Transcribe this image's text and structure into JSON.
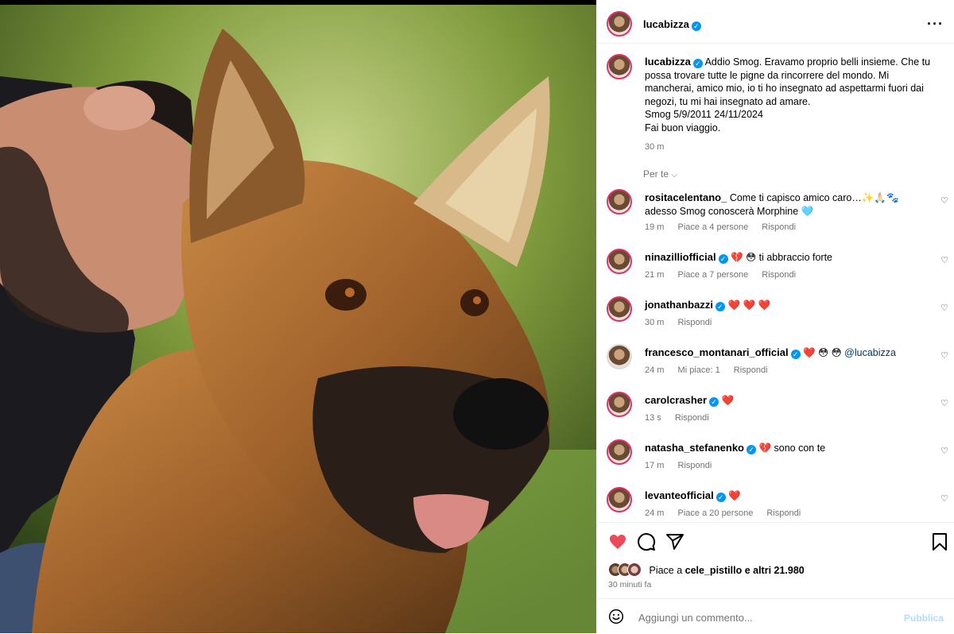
{
  "post": {
    "author": "lucabizza",
    "caption_lines": [
      "Addio Smog. Eravamo proprio belli insieme. Che tu",
      "possa trovare tutte le pigne da rincorrere del mondo. Mi",
      "mancherai, amico mio, io ti ho insegnato ad aspettarmi fuori dai",
      "negozi, tu mi hai insegnato ad amare.",
      "Smog 5/9/2011 24/11/2024",
      "Fai buon viaggio."
    ],
    "caption_time": "30 m",
    "filter_label": "Per te",
    "likes_prefix": "Piace a ",
    "likes_user": "cele_pistillo",
    "likes_suffix": " e altri 21.980",
    "time_ago": "30 minuti fa"
  },
  "comments": [
    {
      "user": "rositacelentano_",
      "verified": false,
      "line1": "Come ti capisco amico caro…✨🙏🏻🐾",
      "line2": "adesso Smog conoscerà Morphine 🩵",
      "time": "19 m",
      "likes": "Piace a 4 persone",
      "reply": "Rispondi"
    },
    {
      "user": "ninazilliofficial",
      "verified": true,
      "line1": "💔 😳 ti abbraccio forte",
      "time": "21 m",
      "likes": "Piace a 7 persone",
      "reply": "Rispondi"
    },
    {
      "user": "jonathanbazzi",
      "verified": true,
      "line1": "❤️ ❤️ ❤️",
      "time": "30 m",
      "likes": "",
      "reply": "Rispondi"
    },
    {
      "user": "francesco_montanari_official",
      "verified": true,
      "line1": "❤️ 😳 😳 ",
      "mention": "@lucabizza",
      "time": "24 m",
      "likes": "Mi piace: 1",
      "reply": "Rispondi"
    },
    {
      "user": "carolcrasher",
      "verified": true,
      "line1": "❤️",
      "time": "13 s",
      "likes": "",
      "reply": "Rispondi"
    },
    {
      "user": "natasha_stefanenko",
      "verified": true,
      "line1": "💔 sono con te",
      "time": "17 m",
      "likes": "",
      "reply": "Rispondi"
    },
    {
      "user": "levanteofficial",
      "verified": true,
      "line1": "❤️",
      "time": "24 m",
      "likes": "Piace a 20 persone",
      "reply": "Rispondi"
    }
  ],
  "input": {
    "placeholder": "Aggiungi un commento...",
    "publish_label": "Pubblica"
  },
  "colors": {
    "like_red": "#ed4956",
    "verified_blue": "#0095f6",
    "publish_disabled": "#b3dbff"
  }
}
